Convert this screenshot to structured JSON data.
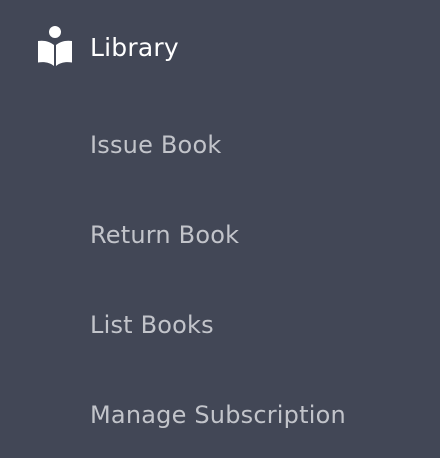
{
  "sidebar": {
    "section": {
      "title": "Library",
      "icon": "book-reader-icon"
    },
    "items": [
      {
        "label": "Issue Book"
      },
      {
        "label": "Return Book"
      },
      {
        "label": "List Books"
      },
      {
        "label": "Manage Subscription"
      }
    ]
  },
  "colors": {
    "background": "#424756",
    "title": "#ffffff",
    "item_text": "#c2c4ca"
  }
}
